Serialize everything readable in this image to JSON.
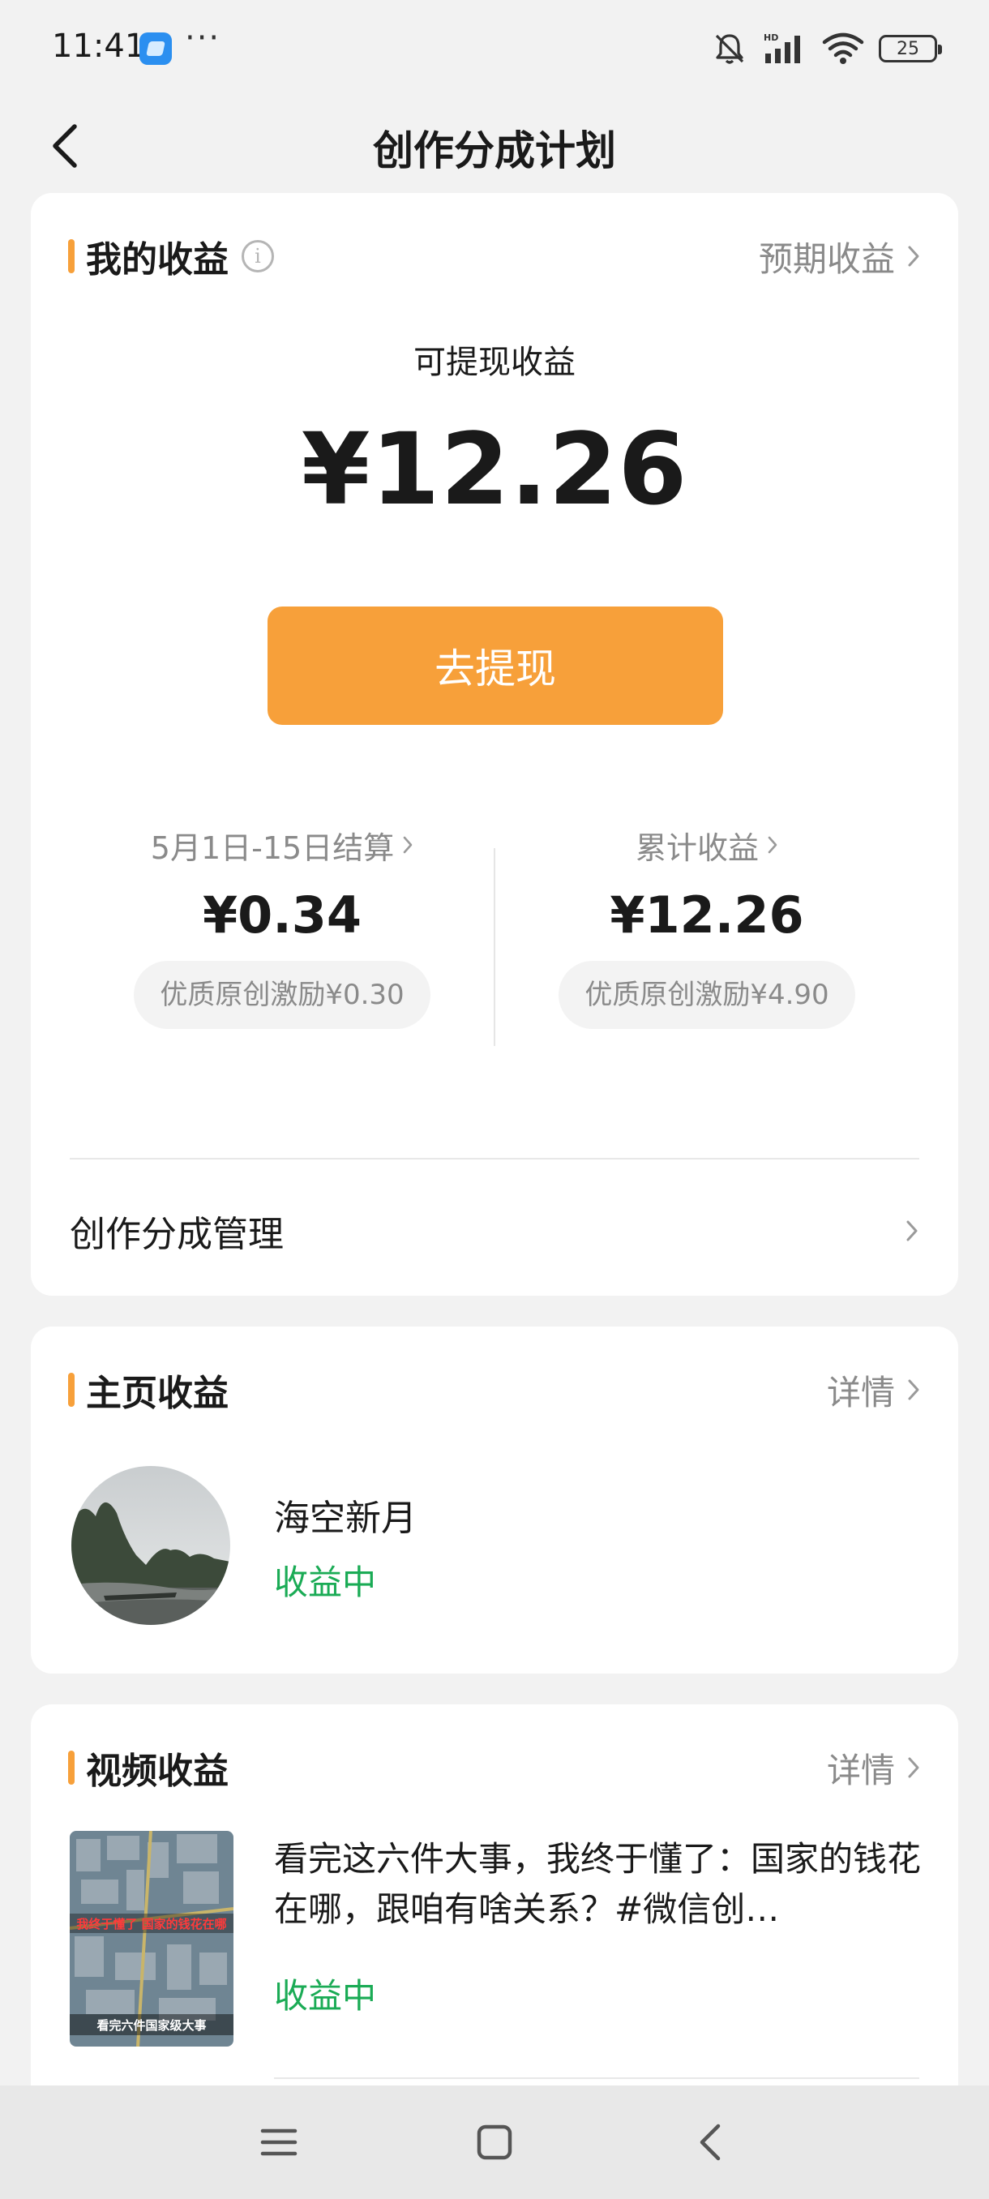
{
  "status_bar": {
    "time": "11:41",
    "dots": "···",
    "battery": "25",
    "icons": [
      "app-icon",
      "bell-muted-icon",
      "hd-signal-icon",
      "wifi-icon",
      "battery-icon"
    ]
  },
  "header": {
    "title": "创作分成计划",
    "back_icon": "chevron-left-icon"
  },
  "earnings": {
    "title": "我的收益",
    "link": "预期收益",
    "withdrawable_label": "可提现收益",
    "withdrawable_amount": "¥12.26",
    "withdraw_button": "去提现",
    "period": {
      "label": "5月1日-15日结算",
      "amount": "¥0.34",
      "incentive": "优质原创激励¥0.30"
    },
    "total": {
      "label": "累计收益",
      "amount": "¥12.26",
      "incentive": "优质原创激励¥4.90"
    },
    "manage_label": "创作分成管理"
  },
  "home_earnings": {
    "title": "主页收益",
    "link": "详情",
    "profile_name": "海空新月",
    "status": "收益中"
  },
  "video_earnings": {
    "title": "视频收益",
    "link": "详情",
    "video_title": "看完这六件大事，我终于懂了：国家的钱花在哪，跟咱有啥关系？#微信创…",
    "status": "收益中",
    "thumb_caption_top": "我终于懂了 国家的钱花在哪",
    "thumb_caption_bottom": "看完六件国家级大事"
  },
  "colors": {
    "accent": "#f7a03a",
    "status_green": "#1aab55",
    "muted": "#8a8a8a"
  }
}
